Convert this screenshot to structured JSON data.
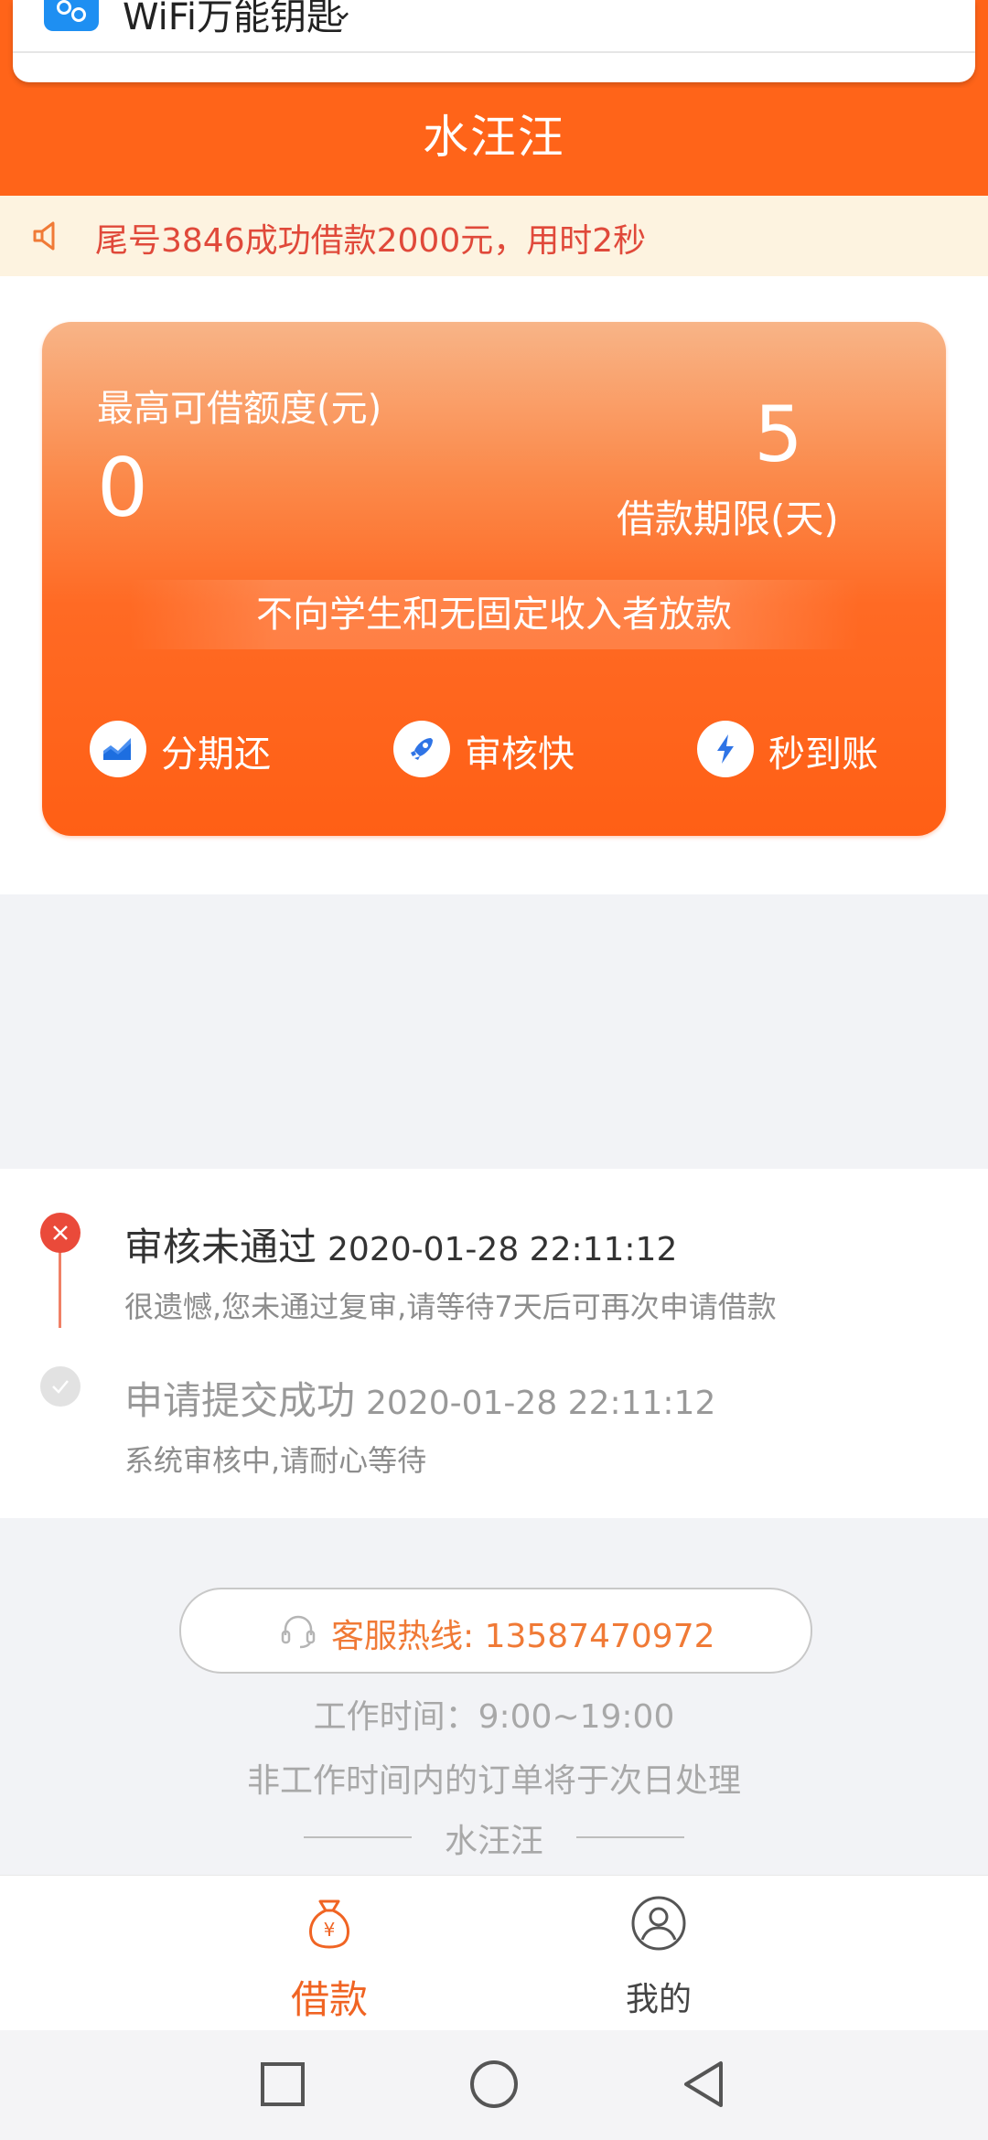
{
  "popup": {
    "app_title": "WiFi万能钥匙"
  },
  "header": {
    "title": "水汪汪"
  },
  "notice": {
    "text": "尾号3846成功借款2000元，用时2秒"
  },
  "loan_card": {
    "max_label": "最高可借额度(元)",
    "max_value": "0",
    "term_value": "5",
    "term_label": "借款期限(天)",
    "strip_text": "不向学生和无固定收入者放款",
    "features": [
      {
        "label": "分期还",
        "icon": "chart-icon"
      },
      {
        "label": "审核快",
        "icon": "rocket-icon"
      },
      {
        "label": "秒到账",
        "icon": "lightning-icon"
      }
    ]
  },
  "timeline": [
    {
      "title": "审核未通过",
      "time": "2020-01-28 22:11:12",
      "desc": "很遗憾,您未通过复审,请等待7天后可再次申请借款",
      "status": "fail"
    },
    {
      "title": "申请提交成功",
      "time": "2020-01-28 22:11:12",
      "desc": "系统审核中,请耐心等待",
      "status": "ok"
    }
  ],
  "service": {
    "hotline": "客服热线: 13587470972",
    "work_time": "工作时间：9:00~19:00",
    "note": "非工作时间内的订单将于次日处理",
    "brand": "水汪汪"
  },
  "tabs": [
    {
      "label": "借款",
      "active": true
    },
    {
      "label": "我的",
      "active": false
    }
  ],
  "colors": {
    "accent": "#ff6419",
    "notice_text": "#e0493a",
    "fail": "#ea4a3a",
    "hotline": "#f07a36"
  }
}
